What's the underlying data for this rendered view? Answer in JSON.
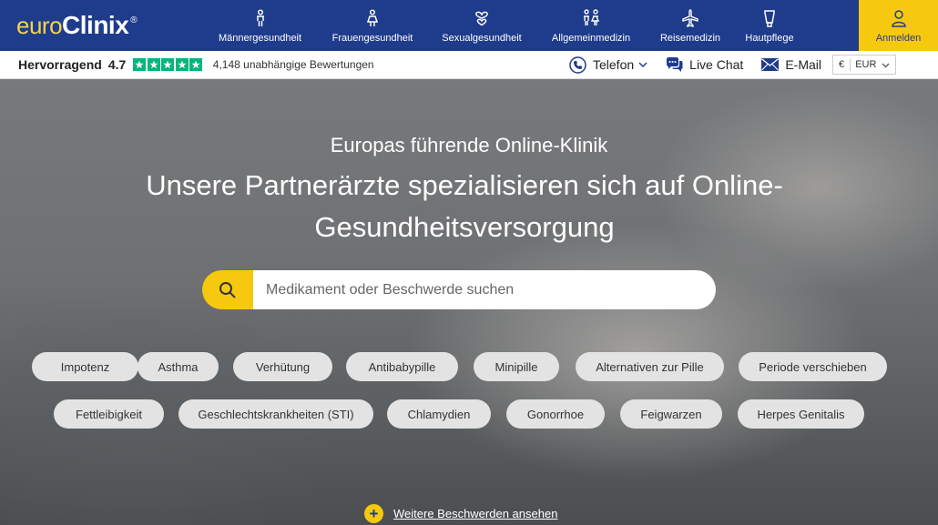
{
  "brand": {
    "logo_euro": "euro",
    "logo_clinix": "Clinix",
    "logo_reg": "®"
  },
  "colors": {
    "navy": "#1f3c8c",
    "yellow": "#f6c90e",
    "trustpilot_green": "#00b67a",
    "chip_bg": "#e3e3e3"
  },
  "nav": {
    "items": [
      {
        "label": "Männergesundheit",
        "icon": "male-icon"
      },
      {
        "label": "Frauengesundheit",
        "icon": "female-icon"
      },
      {
        "label": "Sexualgesundheit",
        "icon": "hearts-icon"
      },
      {
        "label": "Allgemeinmedizin",
        "icon": "family-icon"
      },
      {
        "label": "Reisemedizin",
        "icon": "airplane-icon"
      },
      {
        "label": "Hautpflege",
        "icon": "cream-tube-icon"
      }
    ],
    "login_label": "Anmelden"
  },
  "rating": {
    "label": "Hervorragend",
    "score": "4.7",
    "stars": 5,
    "reviews": "4,148 unabhängige Bewertungen"
  },
  "contact": {
    "phone": "Telefon",
    "chat": "Live Chat",
    "email": "E-Mail",
    "currency_symbol": "€",
    "currency": "EUR"
  },
  "hero": {
    "subtitle": "Europas führende Online-Klinik",
    "title": "Unsere Partnerärzte spezialisieren sich auf Online-Gesundheitsversorgung",
    "search_placeholder": "Medikament oder Beschwerde suchen",
    "search_value": "",
    "chips_row1": [
      "Impotenz",
      "Asthma",
      "Verhütung",
      "Antibabypille",
      "Minipille",
      "Alternativen zur Pille",
      "Periode verschieben"
    ],
    "chips_row2": [
      "Fettleibigkeit",
      "Geschlechtskrankheiten (STI)",
      "Chlamydien",
      "Gonorrhoe",
      "Feigwarzen",
      "Herpes Genitalis"
    ],
    "more_label": "Weitere Beschwerden ansehen"
  }
}
